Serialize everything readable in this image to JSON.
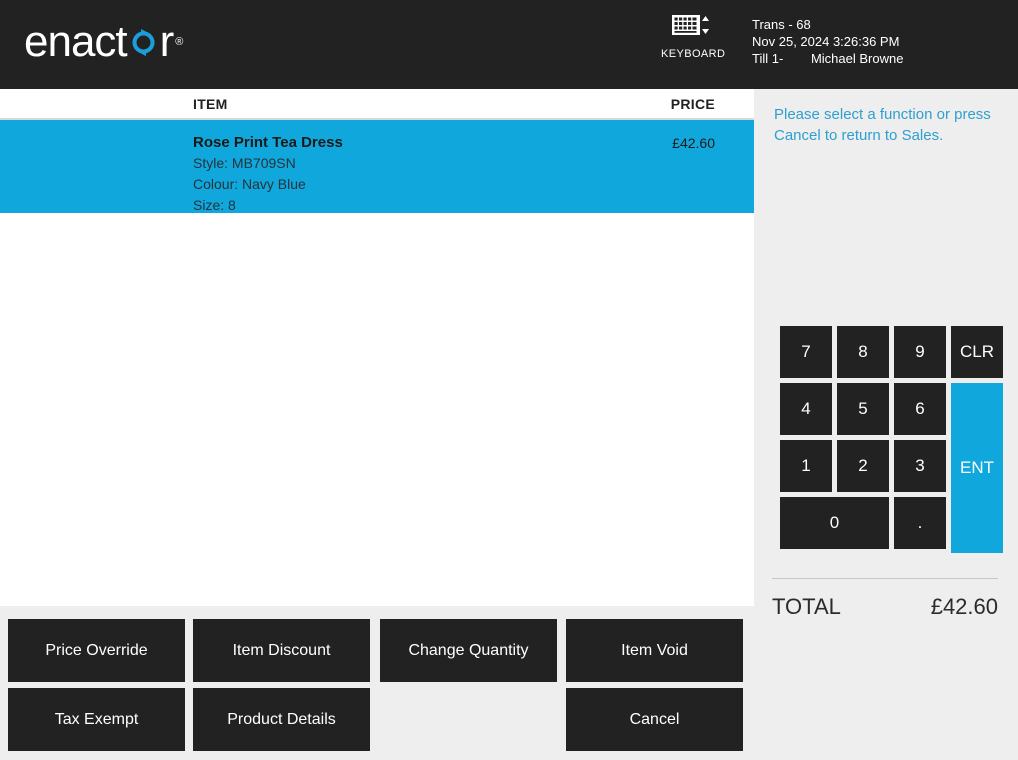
{
  "header": {
    "logo": {
      "text_before": "enact",
      "icon_name": "circular-arrows-icon",
      "text_after": "r",
      "trademark": "®"
    },
    "keyboard_button": {
      "icon_name": "keyboard-icon",
      "label": "KEYBOARD"
    },
    "transaction": {
      "trans": "Trans - 68",
      "datetime": "Nov 25, 2024 3:26:36 PM",
      "till": "Till 1",
      "separator": "-",
      "operator": "Michael Browne"
    }
  },
  "item_list": {
    "columns": {
      "item": "ITEM",
      "price": "PRICE"
    },
    "rows": [
      {
        "name": "Rose Print Tea Dress",
        "attributes": [
          "Style: MB709SN",
          "Colour: Navy Blue",
          "Size: 8"
        ],
        "price": "£42.60",
        "selected": true
      }
    ]
  },
  "function_buttons": [
    {
      "label": "Price Override",
      "col": 0,
      "row": 0
    },
    {
      "label": "Item Discount",
      "col": 1,
      "row": 0
    },
    {
      "label": "Change Quantity",
      "col": 2,
      "row": 0
    },
    {
      "label": "Item Void",
      "col": 3,
      "row": 0
    },
    {
      "label": "Tax Exempt",
      "col": 0,
      "row": 1
    },
    {
      "label": "Product Details",
      "col": 1,
      "row": 1
    },
    {
      "label": "Cancel",
      "col": 3,
      "row": 1
    }
  ],
  "right_panel": {
    "prompt": "Please select a function or press Cancel to return to Sales.",
    "keypad": [
      {
        "label": "7",
        "col": 0,
        "row": 0,
        "width": 1,
        "height": 1,
        "accent": false
      },
      {
        "label": "8",
        "col": 1,
        "row": 0,
        "width": 1,
        "height": 1,
        "accent": false
      },
      {
        "label": "9",
        "col": 2,
        "row": 0,
        "width": 1,
        "height": 1,
        "accent": false
      },
      {
        "label": "CLR",
        "col": 3,
        "row": 0,
        "width": 1,
        "height": 1,
        "accent": false
      },
      {
        "label": "4",
        "col": 0,
        "row": 1,
        "width": 1,
        "height": 1,
        "accent": false
      },
      {
        "label": "5",
        "col": 1,
        "row": 1,
        "width": 1,
        "height": 1,
        "accent": false
      },
      {
        "label": "6",
        "col": 2,
        "row": 1,
        "width": 1,
        "height": 1,
        "accent": false
      },
      {
        "label": "ENT",
        "col": 3,
        "row": 1,
        "width": 1,
        "height": 3,
        "accent": true
      },
      {
        "label": "1",
        "col": 0,
        "row": 2,
        "width": 1,
        "height": 1,
        "accent": false
      },
      {
        "label": "2",
        "col": 1,
        "row": 2,
        "width": 1,
        "height": 1,
        "accent": false
      },
      {
        "label": "3",
        "col": 2,
        "row": 2,
        "width": 1,
        "height": 1,
        "accent": false
      },
      {
        "label": "0",
        "col": 0,
        "row": 3,
        "width": 2,
        "height": 1,
        "accent": false
      },
      {
        "label": ".",
        "col": 2,
        "row": 3,
        "width": 1,
        "height": 1,
        "accent": false
      }
    ],
    "total": {
      "label": "TOTAL",
      "value": "£42.60"
    }
  },
  "colors": {
    "header_bg": "#222222",
    "accent": "#10a8dc",
    "panel_bg": "#eeeeee",
    "button_bg": "#222222",
    "prompt_text": "#2e9fd0"
  }
}
